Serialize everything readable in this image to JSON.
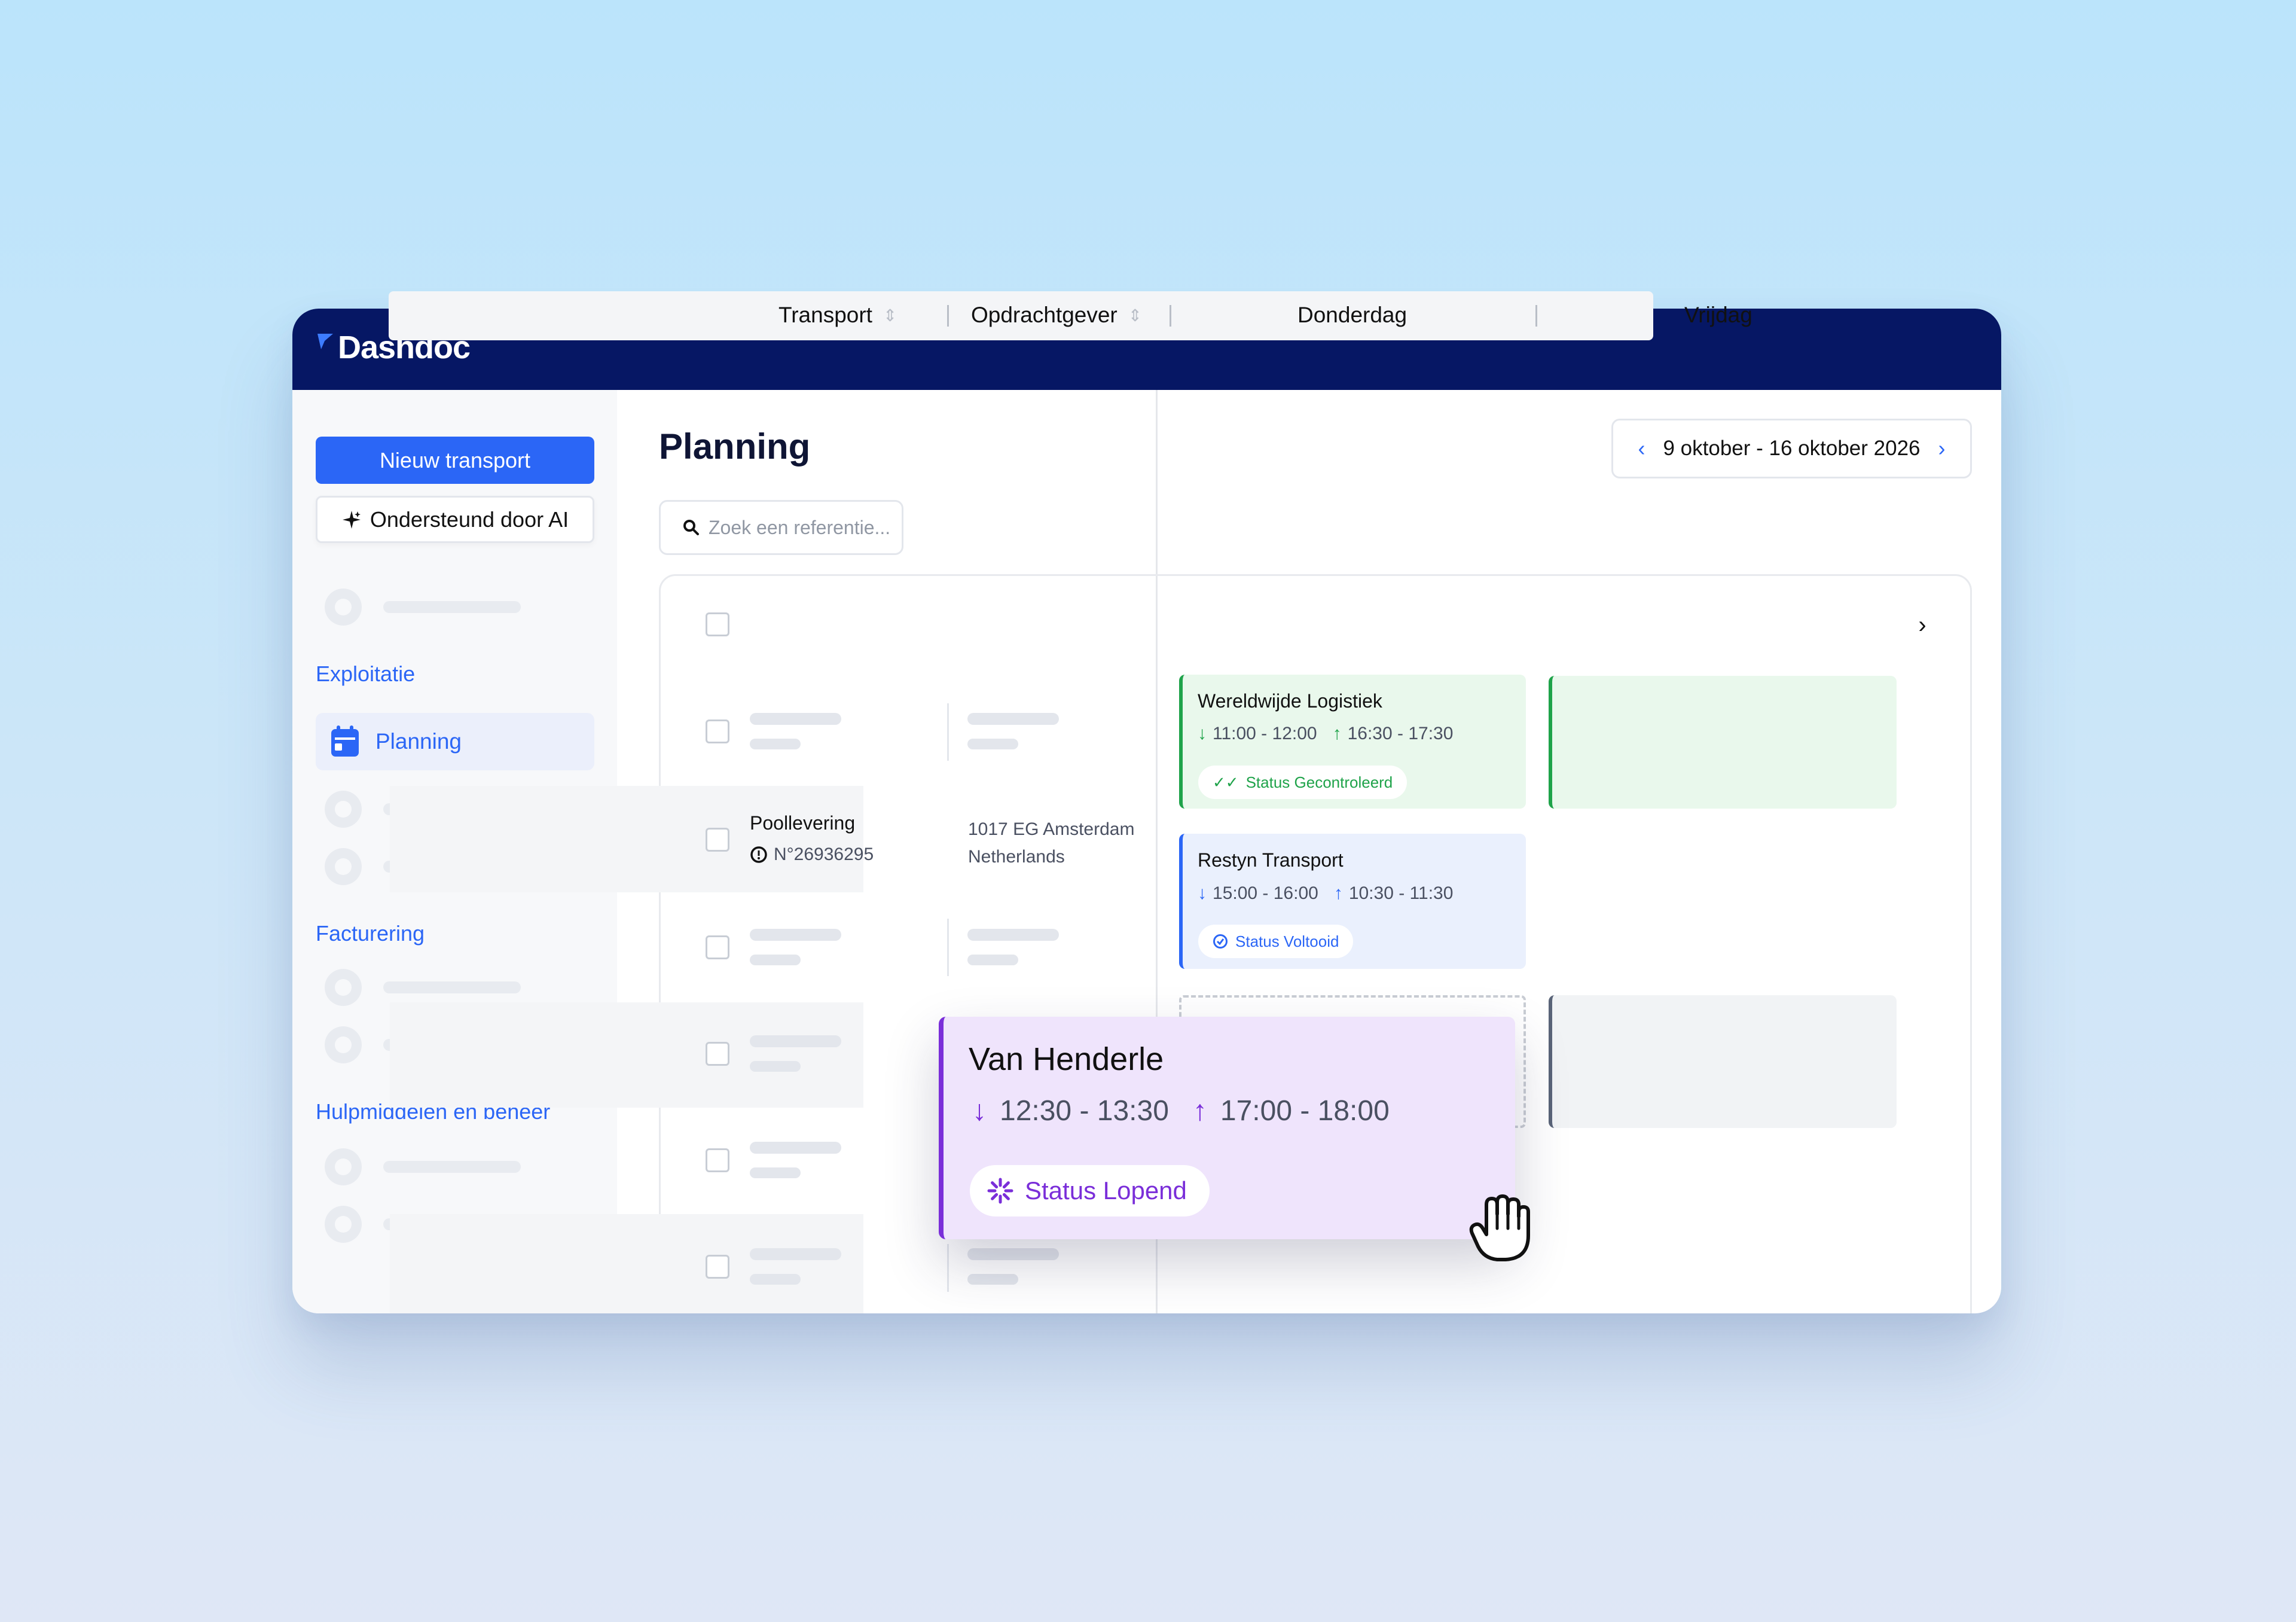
{
  "app": {
    "logo_text": "Dashdoc"
  },
  "sidebar": {
    "new_transport_label": "Nieuw transport",
    "ai_label": "Ondersteund door AI",
    "sections": {
      "exploitatie": "Exploitatie",
      "facturering": "Facturering",
      "hulpmiddelen": "Hulpmiddelen en beheer"
    },
    "active_item": "Planning",
    "icons": {
      "ai": "sparkle-icon",
      "planning": "calendar-icon"
    }
  },
  "main": {
    "title": "Planning",
    "date_range": "9 oktober - 16 oktober 2026",
    "search_placeholder": "Zoek een referentie..."
  },
  "table": {
    "columns": [
      "Transport",
      "Opdrachtgever",
      "Donderdag",
      "Vrijdag"
    ],
    "row": {
      "name": "Poollevering",
      "number": "N°26936295",
      "address_line1": "1017 EG Amsterdam",
      "address_line2": "Netherlands"
    }
  },
  "cards": [
    {
      "name": "Wereldwijde Logistiek",
      "pickup": "11:00 - 12:00",
      "delivery": "16:30 - 17:30",
      "status": "Status Gecontroleerd",
      "color": "#1fa34a"
    },
    {
      "name": "Restyn Transport",
      "pickup": "15:00 - 16:00",
      "delivery": "10:30 - 11:30",
      "status": "Status Voltooid",
      "color": "#2b66f6"
    }
  ],
  "dragged_card": {
    "name": "Van Henderle",
    "pickup": "12:30 - 13:30",
    "delivery": "17:00 - 18:00",
    "status": "Status Lopend",
    "color": "#7a2ed9"
  },
  "colors": {
    "topbar": "#061764",
    "accent": "#2b66f6",
    "background": "#bbe4fb"
  }
}
